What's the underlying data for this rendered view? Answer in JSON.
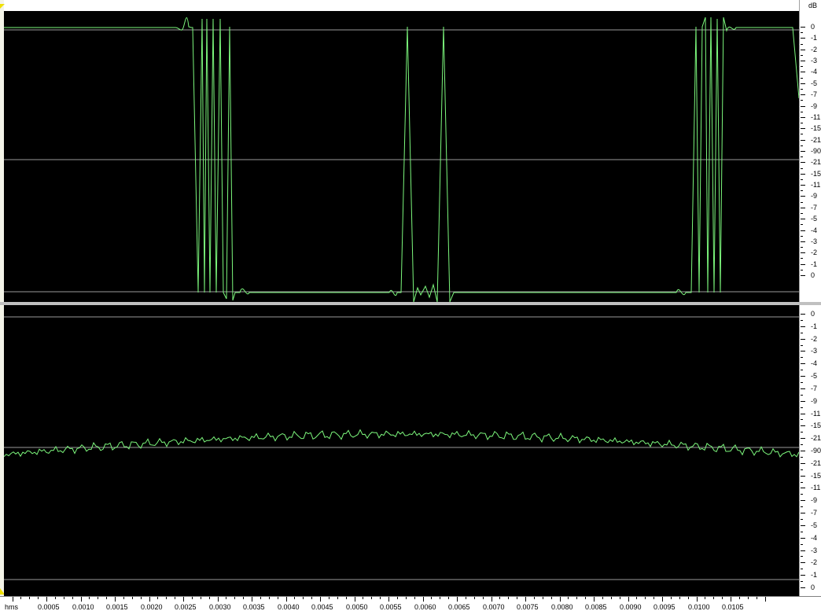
{
  "colors": {
    "background": "#000000",
    "waveform": "#7cf77c",
    "centerline": "#9a9a9a",
    "ruler_bg": "#ffffff",
    "marker": "#f0e000"
  },
  "icons": {
    "start_marker": "yellow-triangle-marker-icon"
  },
  "db_scale": {
    "unit": "dB",
    "top_channel": [
      "0",
      "-1",
      "-2",
      "-3",
      "-4",
      "-5",
      "-7",
      "-9",
      "-11",
      "-15",
      "-21",
      "-90",
      "-21",
      "-15",
      "-11",
      "-9",
      "-7",
      "-5",
      "-4",
      "-3",
      "-2",
      "-1",
      "0"
    ],
    "bottom_channel": [
      "0",
      "-1",
      "-2",
      "-3",
      "-4",
      "-5",
      "-7",
      "-9",
      "-11",
      "-15",
      "-21",
      "-90",
      "-21",
      "-15",
      "-11",
      "-9",
      "-7",
      "-5",
      "-4",
      "-3",
      "-2",
      "-1",
      "0"
    ]
  },
  "time_ruler": {
    "unit_label": "hms",
    "labels": [
      "0.0005",
      "0.0010",
      "0.0015",
      "0.0020",
      "0.0025",
      "0.0030",
      "0.0035",
      "0.0040",
      "0.0045",
      "0.0050",
      "0.0055",
      "0.0060",
      "0.0065",
      "0.0070",
      "0.0075",
      "0.0080",
      "0.0085",
      "0.0090",
      "0.0095",
      "0.0100",
      "0.0105"
    ]
  }
}
